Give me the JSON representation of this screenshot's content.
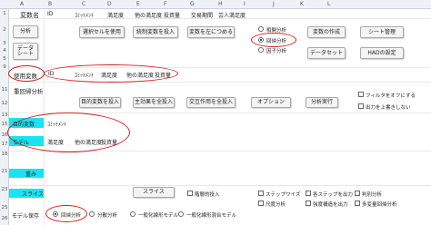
{
  "columns": [
    "A",
    "B",
    "C",
    "D",
    "E",
    "F",
    "G",
    "H",
    "I",
    "J",
    "K",
    "L"
  ],
  "rows": [
    "1",
    "2",
    "3",
    "4",
    "5",
    "6",
    "7",
    "8",
    "9",
    "10",
    "11",
    "12",
    "13",
    "14",
    "15",
    "16",
    "17",
    "18",
    "19",
    "20",
    "21",
    "22",
    "23",
    "24",
    "25",
    "26"
  ],
  "header_row": {
    "a1": "変数名",
    "items": [
      "ID",
      "ｺﾐｯﾄﾒﾝﾄ",
      "満足度",
      "他の満足度",
      "投資量",
      "交易期間",
      "芸人満足度"
    ]
  },
  "left_buttons": {
    "analysis": "分析",
    "data_sheet_line1": "データ",
    "data_sheet_line2": "シート"
  },
  "top_buttons": {
    "select_cell": "選択セルを使用",
    "integrate_vars": "統制変数を投入",
    "vars_left": "変数を左につめる",
    "create_var": "変数の作成",
    "sheet_mgmt": "シート管理",
    "dataset": "データセット",
    "had_settings": "HADの設定"
  },
  "analysis_radios": {
    "items": [
      "相関分析",
      "回帰分析",
      "因子分析"
    ],
    "selected": 1
  },
  "used_vars": {
    "label": "使用変数",
    "items": [
      "ID",
      "ｺﾐｯﾄﾒﾝﾄ",
      "満足度",
      "他の満足度",
      "投資量"
    ]
  },
  "regression_row": {
    "title": "重回帰分析",
    "target_var": "目的変数を投入",
    "main_effect": "主効果を全投入",
    "interaction": "交互作用を全投入",
    "options": "オプション",
    "run": "分析実行",
    "filter_check": "フィルタをオフにする",
    "no_overwrite_check": "出力を上書きしない"
  },
  "model_vars": {
    "target_label": "目的変数",
    "target_value": "ｺﾐｯﾄﾒﾝﾄ",
    "model_label": "モデル",
    "model_values": [
      "満足度",
      "他の満足度",
      "投資量"
    ]
  },
  "lower_labels": {
    "row21": "重み",
    "row23": "スライス"
  },
  "slice_row": {
    "slice_button": "スライス",
    "auto_check": "階層的投入",
    "checks": [
      "ステップワイズ",
      "各ステップを出力",
      "判別分析",
      "尺度分析",
      "強度構造を出力",
      "多変量回帰分析"
    ]
  },
  "model_save": {
    "label": "モデル保存",
    "radios": [
      "回帰分析",
      "分散分析",
      "一般化線形モデル",
      "一般化線形混合モデル"
    ],
    "selected": 0
  },
  "colors": {
    "accent_cyan": "#19e3f0",
    "annotation_red": "#d32020"
  }
}
